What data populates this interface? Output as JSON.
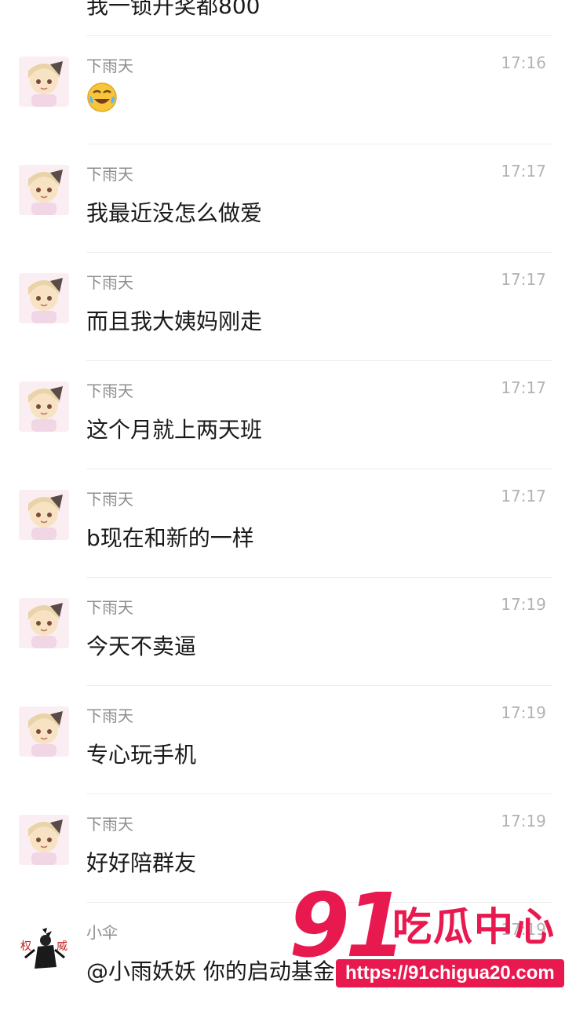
{
  "partial_top": {
    "text": "我一锁开奖都800"
  },
  "messages": [
    {
      "name": "下雨天",
      "time": "17:16",
      "text": "",
      "emoji": "crying-laughing-emoji",
      "avatar": "anime-girl-avatar"
    },
    {
      "name": "下雨天",
      "time": "17:17",
      "text": "我最近没怎么做爱",
      "avatar": "anime-girl-avatar"
    },
    {
      "name": "下雨天",
      "time": "17:17",
      "text": "而且我大姨妈刚走",
      "avatar": "anime-girl-avatar"
    },
    {
      "name": "下雨天",
      "time": "17:17",
      "text": "这个月就上两天班",
      "avatar": "anime-girl-avatar"
    },
    {
      "name": "下雨天",
      "time": "17:17",
      "text": "b现在和新的一样",
      "avatar": "anime-girl-avatar"
    },
    {
      "name": "下雨天",
      "time": "17:19",
      "text": "今天不卖逼",
      "avatar": "anime-girl-avatar"
    },
    {
      "name": "下雨天",
      "time": "17:19",
      "text": "专心玩手机",
      "avatar": "anime-girl-avatar"
    },
    {
      "name": "下雨天",
      "time": "17:19",
      "text": "好好陪群友",
      "avatar": "anime-girl-avatar"
    },
    {
      "name": "小伞",
      "time": "17:19",
      "text": "@小雨妖妖 你的启动基金",
      "avatar": "ink-character-avatar"
    }
  ],
  "watermark": {
    "num": "91",
    "cn": "吃瓜中心",
    "url": "https://91chigua20.com"
  },
  "colors": {
    "accent": "#e8194f",
    "name": "#8e8e8e",
    "time": "#b3b3b3"
  }
}
